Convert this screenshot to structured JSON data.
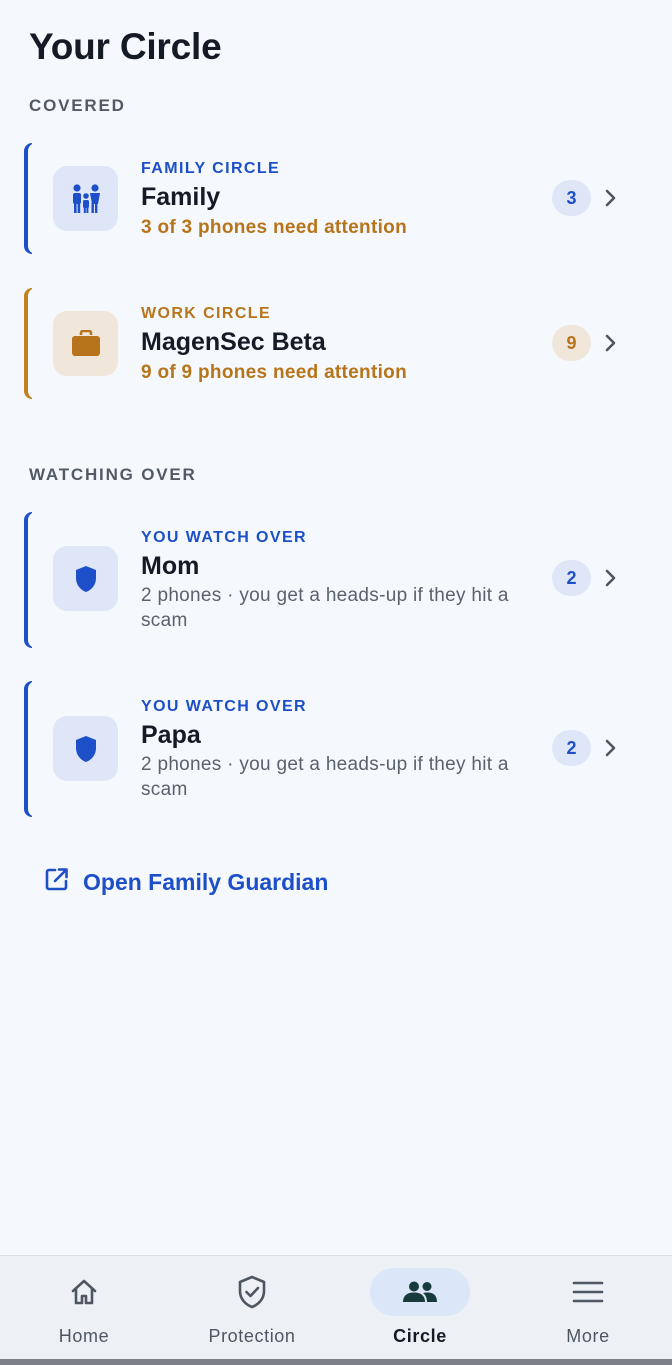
{
  "page_title": "Your Circle",
  "sections": {
    "covered_label": "COVERED",
    "watching_label": "WATCHING OVER"
  },
  "covered": [
    {
      "kicker": "FAMILY CIRCLE",
      "name": "Family",
      "status": "3 of 3 phones need attention",
      "count": "3",
      "icon": "family-icon",
      "accent": "#1d4fc8"
    },
    {
      "kicker": "WORK CIRCLE",
      "name": "MagenSec Beta",
      "status": "9 of 9 phones need attention",
      "count": "9",
      "icon": "briefcase-icon",
      "accent": "#c2811e"
    }
  ],
  "watching": [
    {
      "kicker": "YOU WATCH OVER",
      "name": "Mom",
      "status": "2 phones · you get a heads-up if they hit a scam",
      "count": "2",
      "icon": "shield-icon"
    },
    {
      "kicker": "YOU WATCH OVER",
      "name": "Papa",
      "status": "2 phones · you get a heads-up if they hit a scam",
      "count": "2",
      "icon": "shield-icon"
    }
  ],
  "guardian_link": {
    "label": "Open Family Guardian",
    "icon": "external-link-icon"
  },
  "nav": {
    "items": [
      {
        "label": "Home",
        "icon": "home-icon",
        "active": false
      },
      {
        "label": "Protection",
        "icon": "shield-check-icon",
        "active": false
      },
      {
        "label": "Circle",
        "icon": "people-icon",
        "active": true
      },
      {
        "label": "More",
        "icon": "menu-icon",
        "active": false
      }
    ]
  },
  "colors": {
    "primary": "#1d4fc8",
    "warning": "#b8741a",
    "background": "#f5f8fc"
  }
}
